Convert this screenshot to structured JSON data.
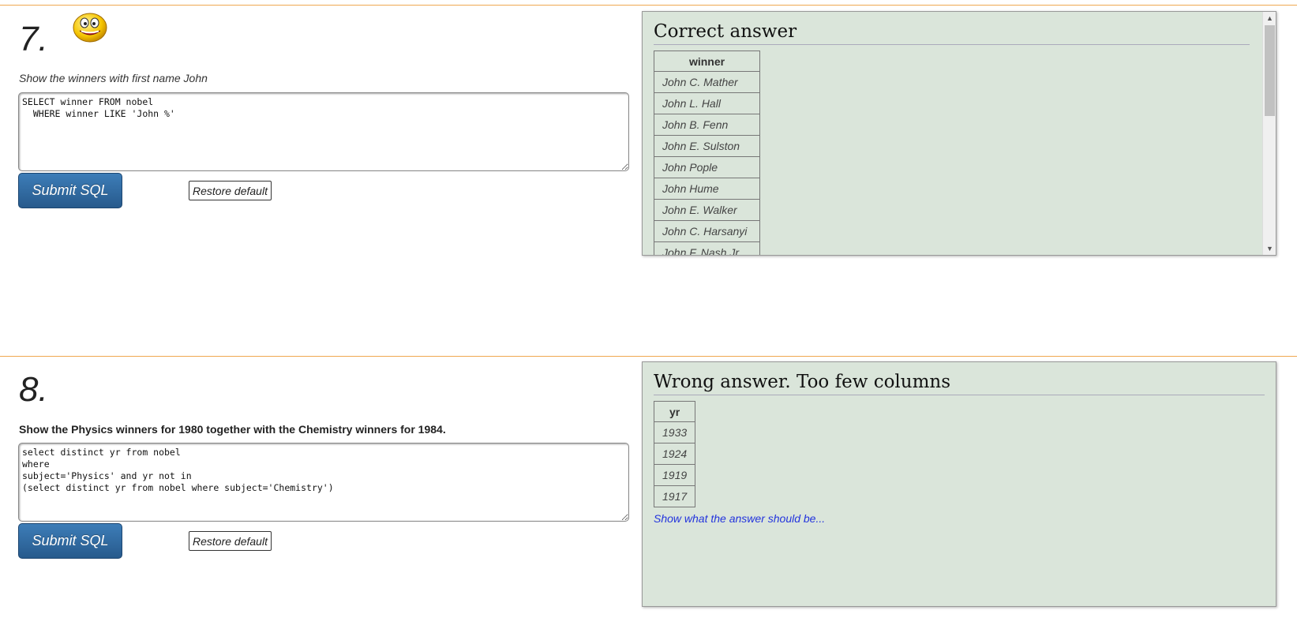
{
  "q7": {
    "number": "7.",
    "prompt": "Show the winners with first name John",
    "sql": "SELECT winner FROM nobel\n  WHERE winner LIKE 'John %'",
    "submit_label": "Submit SQL",
    "restore_label": "Restore default",
    "result_title": "Correct answer",
    "column": "winner",
    "rows": [
      "John C. Mather",
      "John L. Hall",
      "John B. Fenn",
      "John E. Sulston",
      "John Pople",
      "John Hume",
      "John E. Walker",
      "John C. Harsanyi",
      "John F. Nash Jr."
    ]
  },
  "q8": {
    "number": "8.",
    "prompt": "Show the Physics winners for 1980 together with the Chemistry winners for 1984.",
    "sql": "select distinct yr from nobel\nwhere\nsubject='Physics' and yr not in\n(select distinct yr from nobel where subject='Chemistry')",
    "submit_label": "Submit SQL",
    "restore_label": "Restore default",
    "result_title": "Wrong answer. Too few columns",
    "column": "yr",
    "rows": [
      "1933",
      "1924",
      "1919",
      "1917"
    ],
    "show_answer_link": "Show what the answer should be..."
  }
}
